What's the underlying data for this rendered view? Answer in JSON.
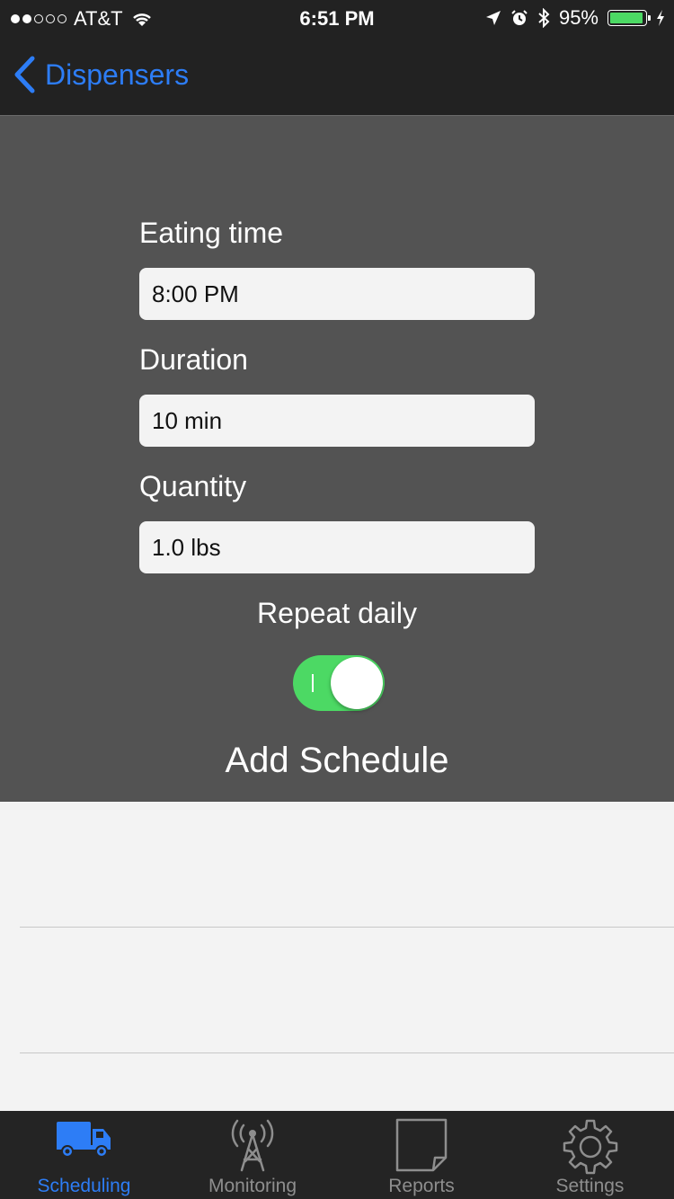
{
  "status_bar": {
    "carrier": "AT&T",
    "time": "6:51 PM",
    "battery": "95%",
    "battery_level": 0.95,
    "battery_color": "#4cd964"
  },
  "nav": {
    "back_label": "Dispensers"
  },
  "form": {
    "eating_time_label": "Eating time",
    "eating_time_value": "8:00 PM",
    "duration_label": "Duration",
    "duration_value": "10 min",
    "quantity_label": "Quantity",
    "quantity_value": "1.0 lbs",
    "repeat_label": "Repeat daily",
    "repeat_on": true,
    "add_button": "Add Schedule"
  },
  "tabs": [
    {
      "label": "Scheduling",
      "icon": "truck-icon",
      "active": true
    },
    {
      "label": "Monitoring",
      "icon": "antenna-icon",
      "active": false
    },
    {
      "label": "Reports",
      "icon": "document-icon",
      "active": false
    },
    {
      "label": "Settings",
      "icon": "gear-icon",
      "active": false
    }
  ],
  "colors": {
    "accent": "#2d7df6",
    "inactive_tab": "#8e8e8e",
    "toggle_on": "#4cd964",
    "panel_bg": "#535353",
    "bar_bg": "#222222"
  }
}
